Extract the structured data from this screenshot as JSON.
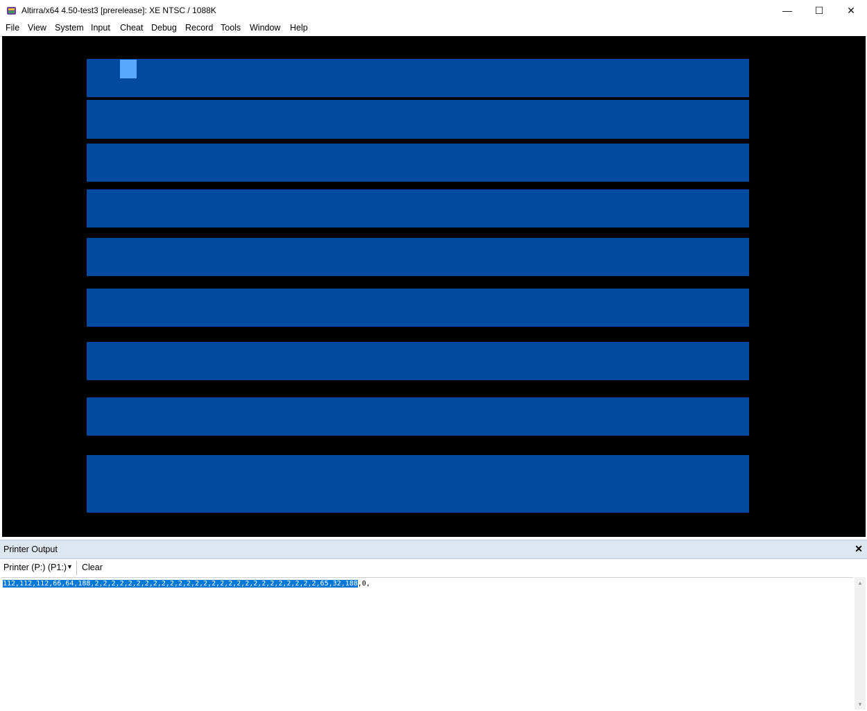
{
  "window": {
    "title": "Altirra/x64 4.50-test3 [prerelease]: XE NTSC / 1088K",
    "minimize": "—",
    "maximize": "☐",
    "close": "✕"
  },
  "menu": [
    {
      "label": "File"
    },
    {
      "label": "View"
    },
    {
      "label": "System"
    },
    {
      "label": "Input"
    },
    {
      "label": "Cheat"
    },
    {
      "label": "Debug"
    },
    {
      "label": "Record"
    },
    {
      "label": "Tools"
    },
    {
      "label": "Window"
    },
    {
      "label": "Help"
    }
  ],
  "colors": {
    "screen_bg": "#000000",
    "stripe": "#004b9f",
    "cursor": "#5aa8ff",
    "selection": "#0078d7"
  },
  "printer_pane": {
    "title": "Printer Output",
    "close": "✕",
    "printer_select": "Printer (P:) (P1:)",
    "dropdown": "▼",
    "clear_label": "Clear",
    "output_selected": "112,112,112,66,64,188,2,2,2,2,2,2,2,2,2,2,2,2,2,2,2,2,2,2,2,2,2,2,2,2,2,2,2,65,32,188",
    "output_rest": ",0,",
    "scroll_up": "▲",
    "scroll_down": "▼"
  }
}
